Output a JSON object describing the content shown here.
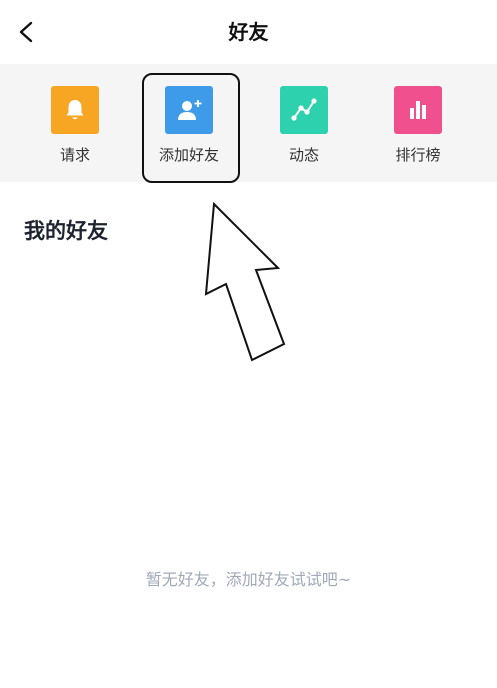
{
  "header": {
    "title": "好友",
    "back_icon": "chevron-left-icon"
  },
  "actions": [
    {
      "label": "请求",
      "icon": "bell-icon",
      "color": "#F6A623"
    },
    {
      "label": "添加好友",
      "icon": "add-user-icon",
      "color": "#3D9BE9"
    },
    {
      "label": "动态",
      "icon": "trend-icon",
      "color": "#2ED1AE"
    },
    {
      "label": "排行榜",
      "icon": "bar-chart-icon",
      "color": "#F0508E"
    }
  ],
  "section": {
    "title": "我的好友"
  },
  "empty_state": {
    "text": "暂无好友，添加好友试试吧~"
  }
}
